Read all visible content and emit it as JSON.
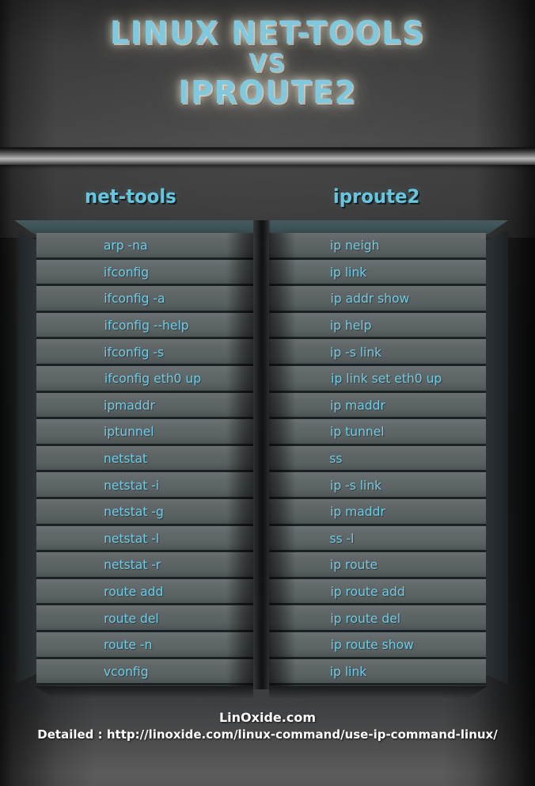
{
  "poster": {
    "title_line1": "LINUX NET-TOOLS",
    "title_line2": "VS",
    "title_line3": "IPROUTE2",
    "accent_color": "#80c8dd",
    "row_text_color": "#6fcbe3",
    "row_bg_color": "#5b6264",
    "cap_color": "#3d5257",
    "background_color": "#3b3b3b"
  },
  "columns": {
    "left_header": "net-tools",
    "right_header": "iproute2"
  },
  "comparison": {
    "rows": [
      {
        "net_tools": "arp -na",
        "iproute2": "ip neigh"
      },
      {
        "net_tools": "ifconfig",
        "iproute2": "ip link"
      },
      {
        "net_tools": "ifconfig -a",
        "iproute2": "ip addr show"
      },
      {
        "net_tools": "ifconfig --help",
        "iproute2": "ip help"
      },
      {
        "net_tools": "ifconfig -s",
        "iproute2": "ip -s link"
      },
      {
        "net_tools": "ifconfig eth0 up",
        "iproute2": "ip link set eth0 up"
      },
      {
        "net_tools": "ipmaddr",
        "iproute2": "ip maddr"
      },
      {
        "net_tools": "iptunnel",
        "iproute2": "ip tunnel"
      },
      {
        "net_tools": "netstat",
        "iproute2": "ss"
      },
      {
        "net_tools": "netstat -i",
        "iproute2": "ip -s link"
      },
      {
        "net_tools": "netstat  -g",
        "iproute2": "ip maddr"
      },
      {
        "net_tools": "netstat -l",
        "iproute2": "ss -l"
      },
      {
        "net_tools": "netstat -r",
        "iproute2": "ip route"
      },
      {
        "net_tools": "route add",
        "iproute2": "ip route add"
      },
      {
        "net_tools": "route del",
        "iproute2": "ip route del"
      },
      {
        "net_tools": "route -n",
        "iproute2": "ip route show"
      },
      {
        "net_tools": "vconfig",
        "iproute2": "ip link"
      }
    ]
  },
  "footer": {
    "brand": "LinOxide.com",
    "url_line": "Detailed : http://linoxide.com/linux-command/use-ip-command-linux/"
  }
}
